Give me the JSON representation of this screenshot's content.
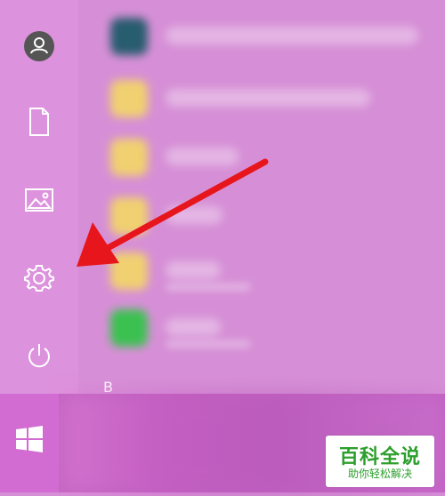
{
  "rail": {
    "icons": [
      {
        "name": "user-icon"
      },
      {
        "name": "documents-icon"
      },
      {
        "name": "pictures-icon"
      },
      {
        "name": "settings-icon"
      },
      {
        "name": "power-icon"
      }
    ]
  },
  "app_list": {
    "section_letter": "B",
    "items": [
      {
        "tile_color": "#1f5a6a"
      },
      {
        "tile_color": "#f2d46b"
      },
      {
        "tile_color": "#f2d46b"
      },
      {
        "tile_color": "#f2d46b"
      },
      {
        "tile_color": "#f2d46b"
      },
      {
        "tile_color": "#33c449"
      }
    ]
  },
  "taskbar": {
    "start_icon": "windows-logo-icon"
  },
  "watermark": {
    "title": "百科全说",
    "subtitle": "助你轻松解决"
  },
  "annotation": {
    "arrow_color": "#e7161b"
  }
}
